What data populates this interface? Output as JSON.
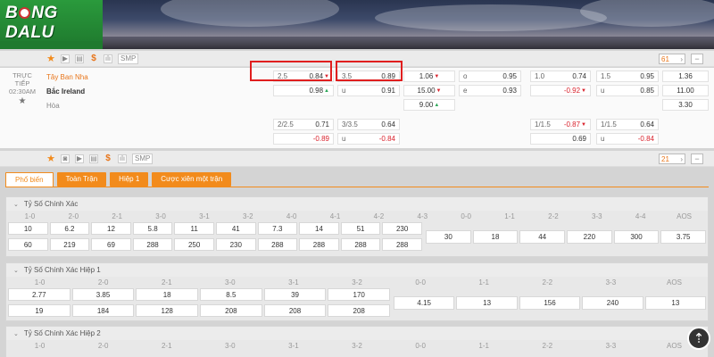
{
  "logo": {
    "prefix": "B",
    "suffix": "NG",
    "word2": "DALU"
  },
  "toolbar1": {
    "smp": "SMP",
    "pager": "61"
  },
  "toolbar2": {
    "smp": "SMP",
    "pager": "21"
  },
  "match": {
    "live_label": "TRỰC TIẾP",
    "time": "02:30AM",
    "home": "Tây Ban Nha",
    "away": "Bắc Ireland",
    "draw": "Hòa"
  },
  "odds": {
    "hdp1": {
      "line": "2.5",
      "home": "0.84",
      "away": "0.98"
    },
    "ou1": {
      "line": "3.5",
      "over": "0.89",
      "u": "u",
      "under": "0.91"
    },
    "x12": {
      "home": "1.06",
      "away": "15.00",
      "draw": "9.00"
    },
    "oe": {
      "o": "o",
      "ov": "0.95",
      "e": "e",
      "ev": "0.93"
    },
    "hdp_h1": {
      "line": "1.0",
      "home": "0.74",
      "away": "-0.92"
    },
    "ou_h1": {
      "line": "1.5",
      "over": "0.95",
      "u": "u",
      "under": "0.85"
    },
    "x12_h1": {
      "home": "1.36",
      "away": "11.00",
      "draw": "3.30"
    },
    "hdp2": {
      "line": "2/2.5",
      "home": "0.71",
      "away": "-0.89"
    },
    "ou2": {
      "line": "3/3.5",
      "over": "0.64",
      "u": "u",
      "under": "-0.84"
    },
    "hdp_h1_2": {
      "line": "1/1.5",
      "home": "-0.87",
      "away": "0.69"
    },
    "ou_h1_2": {
      "line": "1/1.5",
      "over": "0.64",
      "u": "u",
      "under": "-0.84"
    }
  },
  "tabs": [
    "Phổ biến",
    "Toàn Trận",
    "Hiệp 1",
    "Cược xiên một trận"
  ],
  "sec1": {
    "title": "Tỷ Số Chính Xác",
    "labels": [
      "1-0",
      "2-0",
      "2-1",
      "3-0",
      "3-1",
      "3-2",
      "4-0",
      "4-1",
      "4-2",
      "4-3",
      "0-0",
      "1-1",
      "2-2",
      "3-3",
      "4-4",
      "AOS"
    ],
    "row1": [
      "10",
      "6.2",
      "12",
      "5.8",
      "11",
      "41",
      "7.3",
      "14",
      "51",
      "230"
    ],
    "row2": [
      "60",
      "219",
      "69",
      "288",
      "250",
      "230",
      "288",
      "288",
      "288",
      "288"
    ],
    "mid": [
      "30",
      "18",
      "44",
      "220",
      "300",
      "3.75"
    ]
  },
  "sec2": {
    "title": "Tỷ Số Chính Xác Hiệp 1",
    "labels": [
      "1-0",
      "2-0",
      "2-1",
      "3-0",
      "3-1",
      "3-2",
      "0-0",
      "1-1",
      "2-2",
      "3-3",
      "AOS"
    ],
    "row1": [
      "2.77",
      "3.85",
      "18",
      "8.5",
      "39",
      "170"
    ],
    "row2": [
      "19",
      "184",
      "128",
      "208",
      "208",
      "208"
    ],
    "mid": [
      "4.15",
      "13",
      "156",
      "240",
      "13"
    ]
  },
  "sec3": {
    "title": "Tỷ Số Chính Xác Hiệp 2",
    "labels": [
      "1-0",
      "2-0",
      "2-1",
      "3-0",
      "3-1",
      "3-2",
      "0-0",
      "1-1",
      "2-2",
      "3-3",
      "AOS"
    ]
  },
  "colors": {
    "accent": "#f28b1c",
    "red": "#d9232d",
    "green": "#2ea85a",
    "logo_bg": "#2a9a3c"
  }
}
